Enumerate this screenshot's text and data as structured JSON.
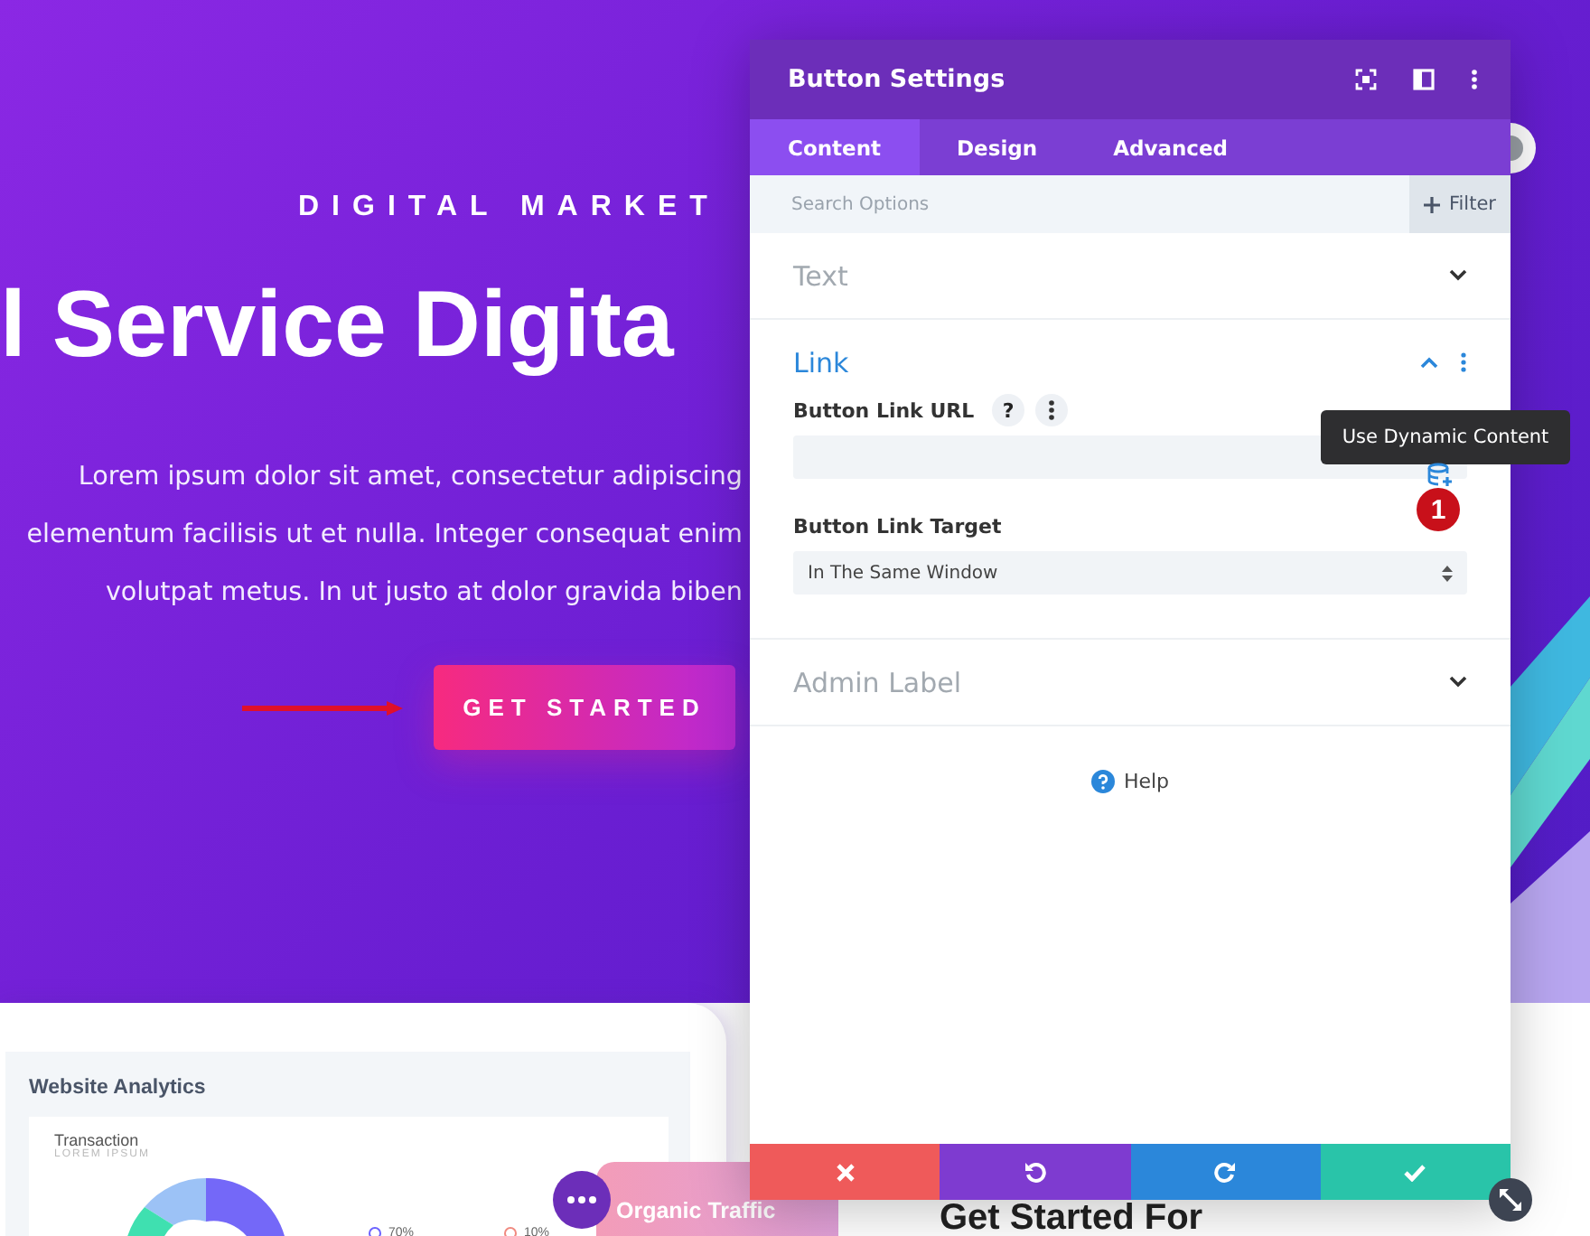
{
  "hero": {
    "eyebrow": "DIGITAL MARKET",
    "heading": "l Service Digita",
    "paragraph_lines": [
      "Lorem ipsum dolor sit amet, consectetur adipiscing",
      "elementum facilisis ut et nulla. Integer consequat enim",
      "volutpat metus. In ut justo at dolor gravida biben"
    ],
    "cta": "GET STARTED"
  },
  "analytics_card": {
    "title": "Website Analytics",
    "subtitle": "Transaction",
    "caption": "LOREM IPSUM",
    "legend": [
      {
        "value": "70%",
        "color": "#6c63ff"
      },
      {
        "value": "10%",
        "color": "#f08a80"
      }
    ]
  },
  "floating_card": {
    "title": "Organic Traffic"
  },
  "section_heading": "Get Started For",
  "panel": {
    "title": "Button Settings",
    "tabs": [
      {
        "label": "Content",
        "selected": true
      },
      {
        "label": "Design",
        "selected": false
      },
      {
        "label": "Advanced",
        "selected": false
      }
    ],
    "search": {
      "placeholder": "Search Options"
    },
    "filter_button": "Filter",
    "sections": [
      {
        "title": "Text",
        "expanded": false
      },
      {
        "title": "Link",
        "expanded": true,
        "fields": [
          {
            "kind": "text",
            "label": "Button Link URL",
            "help_mark": "?"
          },
          {
            "kind": "select",
            "label": "Button Link Target",
            "value": "In The Same Window"
          }
        ]
      },
      {
        "title": "Admin Label",
        "expanded": false
      }
    ],
    "help": "Help",
    "tooltip": "Use Dynamic Content",
    "badge": "1",
    "footer_buttons": [
      {
        "kind": "discard"
      },
      {
        "kind": "undo"
      },
      {
        "kind": "redo"
      },
      {
        "kind": "save"
      }
    ]
  }
}
